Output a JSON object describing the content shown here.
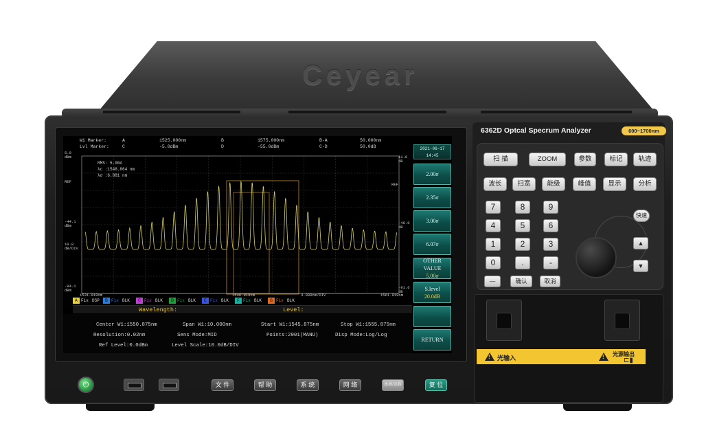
{
  "brand_logo": "Ceyear",
  "panel_title": "6362D Optcal Specrum Analyzer",
  "range_badge": "600~1700nm",
  "markers": {
    "w1_label": "W1  Marker:",
    "lvl_label": "Lvl Marker:",
    "a": "A",
    "a_val": "1525.000nm",
    "c": "C",
    "c_val": "-5.0dBm",
    "b": "B",
    "b_val": "1575.000nm",
    "d": "D",
    "d_val": "-55.0dBm",
    "ba": "B-A",
    "ba_val": "50.000nm",
    "cd": "C-D",
    "cd_val": "50.0dB"
  },
  "plot": {
    "top_label_1": "5.0",
    "top_label_2": "dBm",
    "ref_left": "REF",
    "ref_right": "REF",
    "mid_label_1": "-44.1",
    "mid_label_2": "dBm",
    "div_label_1": "10.0",
    "div_label_2": "dB/DIV",
    "bot_label_1": "-94.1",
    "bot_label_2": "dBm",
    "right_top_1": "11.6",
    "right_top_2": "dB",
    "right_mid_1": "-40.0",
    "right_mid_2": "dB",
    "right_bot_1": "-91.6",
    "right_bot_2": "dB",
    "x_start": "1531.919nm",
    "x_mid": "1546.919nm",
    "x_div": "3.000nm/DIV",
    "x_end": "1561.919nm",
    "rms_1": "RMS: 5.00σ",
    "rms_2": "λc  :1548.864 nm",
    "rms_3": "λσ  :6.881 nm"
  },
  "trace_bar": [
    {
      "letter": "A",
      "color": "#e8d23c",
      "mode": "Fix",
      "disp": "DSP"
    },
    {
      "letter": "B",
      "color": "#2a7de0",
      "mode": "Fix",
      "disp": "BLK"
    },
    {
      "letter": "C",
      "color": "#c040d8",
      "mode": "Fix",
      "disp": "BLK"
    },
    {
      "letter": "D",
      "color": "#1c9e3a",
      "mode": "Fix",
      "disp": "BLK"
    },
    {
      "letter": "E",
      "color": "#3656e6",
      "mode": "Fix",
      "disp": "BLK"
    },
    {
      "letter": "F",
      "color": "#16b0a0",
      "mode": "Fix",
      "disp": "BLK"
    },
    {
      "letter": "G",
      "color": "#e06a22",
      "mode": "Fix",
      "disp": "BLK"
    }
  ],
  "wavelength_label": "Wavelength:",
  "level_label": "Level:",
  "info": {
    "center": "Center W1:1550.875nm",
    "span": "Span W1:10.000nm",
    "start": "Start W1:1545.875nm",
    "stop": "Stop W1:1555.875nm",
    "resolution": "Resolution:0.02nm",
    "sens": "Sens Mode:MID",
    "points": "Points:2001(MANU)",
    "disp": "Disp Mode:Log/Log",
    "ref": "Ref Level:0.0dBm",
    "scale": "Level Scale:10.0dB/DIV"
  },
  "datetime": {
    "date": "2021-06-17",
    "time": "14:45"
  },
  "softkeys": {
    "k1": "2.00σ",
    "k2": "2.35σ",
    "k3": "3.00σ",
    "k4": "6.07σ",
    "k5_label": "OTHER VALUE",
    "k5_value": "5.00σ",
    "k6_label": "S.level",
    "k6_value": "20.0dB",
    "k7": "",
    "k8": "RETURN"
  },
  "function_keys": {
    "scan": "扫 描",
    "zoom": "ZOOM",
    "params": "参数",
    "marker": "标记",
    "trace": "轨迹",
    "wavelength": "波长",
    "sweep_width": "扫宽",
    "level": "能级",
    "peak": "峰值",
    "display": "显示",
    "analysis": "分析"
  },
  "numpad": {
    "n7": "7",
    "n8": "8",
    "n9": "9",
    "n4": "4",
    "n5": "5",
    "n6": "6",
    "n1": "1",
    "n2": "2",
    "n3": "3",
    "n0": "0",
    "dot": ".",
    "minus": "-",
    "back": "—",
    "confirm": "确认",
    "cancel": "取消"
  },
  "quick": "快速",
  "arrows": {
    "up": "▲",
    "down": "▼"
  },
  "bottom_buttons": {
    "file": "文 件",
    "help": "帮 助",
    "system": "系 统",
    "network": "网 络",
    "local": "本地/远程",
    "reset": "复 位"
  },
  "power_symbol": "⏻",
  "ports": {
    "light_in": "光输入",
    "light_out": "光源输出"
  },
  "colors": {
    "trace": "#d7d06a",
    "grid": "#3b3b3b",
    "softkey": "#0d4f4a",
    "badge": "#f2c84b"
  }
}
